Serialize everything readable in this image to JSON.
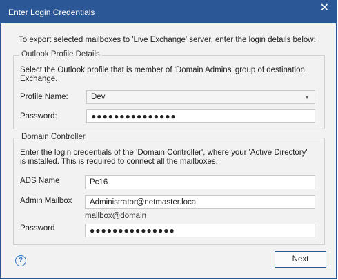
{
  "window": {
    "title": "Enter Login Credentials",
    "close_glyph": "✕"
  },
  "intro": "To export selected mailboxes to 'Live Exchange' server, enter the login details below:",
  "outlook_group": {
    "label": "Outlook Profile Details",
    "description": "Select the Outlook profile that is member of 'Domain Admins' group of destination Exchange.",
    "profile_label": "Profile Name:",
    "profile_value": "Dev",
    "password_label": "Password:",
    "password_value": "●●●●●●●●●●●●●●●"
  },
  "domain_group": {
    "label": "Domain Controller",
    "description": "Enter the login credentials of the 'Domain Controller', where your 'Active Directory' is installed. This is required to connect all the mailboxes.",
    "ads_label": "ADS Name",
    "ads_value": "Pc16",
    "mailbox_label": "Admin Mailbox",
    "mailbox_value": "Administrator@netmaster.local",
    "mailbox_hint": "mailbox@domain",
    "password_label": "Password",
    "password_value": "●●●●●●●●●●●●●●●"
  },
  "footer": {
    "help_glyph": "?",
    "next_label": "Next"
  },
  "colors": {
    "accent": "#2b5797",
    "help": "#2b73c4"
  }
}
